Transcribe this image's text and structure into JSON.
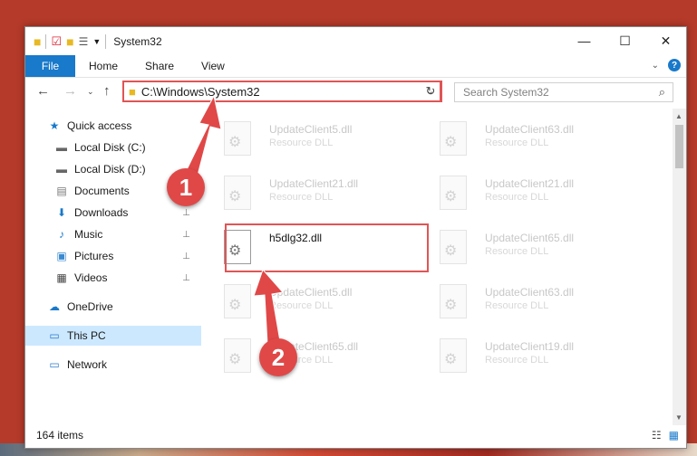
{
  "window": {
    "title": "System32",
    "controls": [
      "—",
      "☐",
      "✕"
    ]
  },
  "ribbon": {
    "file": "File",
    "tabs": [
      "Home",
      "Share",
      "View"
    ]
  },
  "address": {
    "path": "C:\\Windows\\System32",
    "search_placeholder": "Search System32"
  },
  "nav": {
    "items": [
      {
        "label": "Quick access",
        "icon": "star-icon"
      },
      {
        "label": "Local Disk (C:)",
        "icon": "drive-icon"
      },
      {
        "label": "Local Disk (D:)",
        "icon": "drive-icon"
      },
      {
        "label": "Documents",
        "icon": "documents-icon"
      },
      {
        "label": "Downloads",
        "icon": "download-icon"
      },
      {
        "label": "Music",
        "icon": "music-icon"
      },
      {
        "label": "Pictures",
        "icon": "pictures-icon"
      },
      {
        "label": "Videos",
        "icon": "videos-icon"
      },
      {
        "label": "OneDrive",
        "icon": "cloud-icon"
      },
      {
        "label": "This PC",
        "icon": "pc-icon"
      },
      {
        "label": "Network",
        "icon": "network-icon"
      }
    ]
  },
  "files": [
    {
      "name": "UpdateClient5.dll",
      "type": "Resource DLL"
    },
    {
      "name": "UpdateClient63.dll",
      "type": "Resource DLL"
    },
    {
      "name": "UpdateClient21.dll",
      "type": "Resource DLL"
    },
    {
      "name": "UpdateClient21.dll",
      "type": "Resource DLL"
    },
    {
      "name": "h5dlg32.dll",
      "type": ""
    },
    {
      "name": "UpdateClient65.dll",
      "type": "Resource DLL"
    },
    {
      "name": "UpdateClient5.dll",
      "type": "Resource DLL"
    },
    {
      "name": "UpdateClient63.dll",
      "type": "Resource DLL"
    },
    {
      "name": "UpdateClient65.dll",
      "type": "Resource DLL"
    },
    {
      "name": "UpdateClient19.dll",
      "type": "Resource DLL"
    }
  ],
  "status": {
    "count": "164 items"
  },
  "annotations": {
    "step1": "1",
    "step2": "2"
  },
  "colors": {
    "accent": "#1979ca",
    "highlight": "#e05555",
    "selected_nav": "#cce8ff"
  }
}
